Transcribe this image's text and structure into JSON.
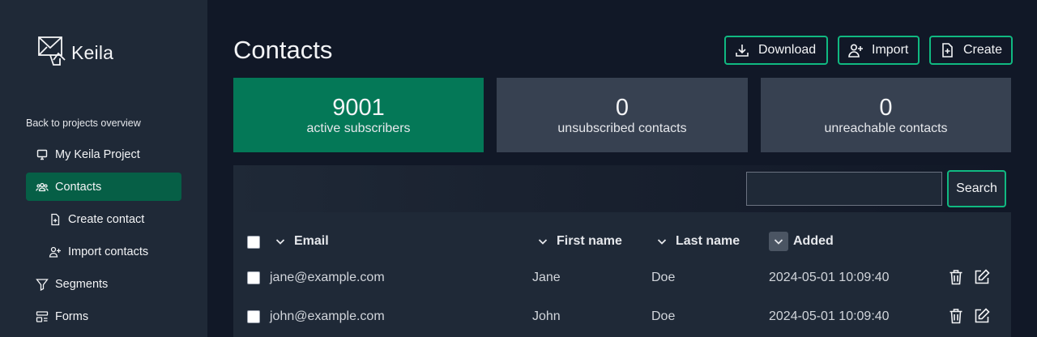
{
  "app": {
    "name": "Keila"
  },
  "sidebar": {
    "back_label": "Back to projects overview",
    "items": [
      {
        "label": "My Keila Project",
        "icon": "monitor-icon"
      },
      {
        "label": "Contacts",
        "icon": "users-icon",
        "active": true
      },
      {
        "label": "Create contact",
        "icon": "file-plus-icon",
        "sub": true
      },
      {
        "label": "Import contacts",
        "icon": "user-plus-icon",
        "sub": true
      },
      {
        "label": "Segments",
        "icon": "filter-icon"
      },
      {
        "label": "Forms",
        "icon": "form-icon"
      }
    ]
  },
  "header": {
    "title": "Contacts",
    "download_label": "Download",
    "import_label": "Import",
    "create_label": "Create"
  },
  "stats": [
    {
      "value": "9001",
      "label": "active subscribers",
      "color": "#047857"
    },
    {
      "value": "0",
      "label": "unsubscribed contacts",
      "color": "#374151"
    },
    {
      "value": "0",
      "label": "unreachable contacts",
      "color": "#374151"
    }
  ],
  "search": {
    "value": "",
    "button_label": "Search"
  },
  "table": {
    "columns": [
      "Email",
      "First name",
      "Last name",
      "Added"
    ],
    "rows": [
      {
        "email": "jane@example.com",
        "first": "Jane",
        "last": "Doe",
        "added": "2024-05-01 10:09:40"
      },
      {
        "email": "john@example.com",
        "first": "John",
        "last": "Doe",
        "added": "2024-05-01 10:09:40"
      }
    ]
  },
  "colors": {
    "accent": "#10b981",
    "active_nav": "#065f46",
    "sidebar_bg": "#1f2937",
    "page_bg": "#111827"
  }
}
